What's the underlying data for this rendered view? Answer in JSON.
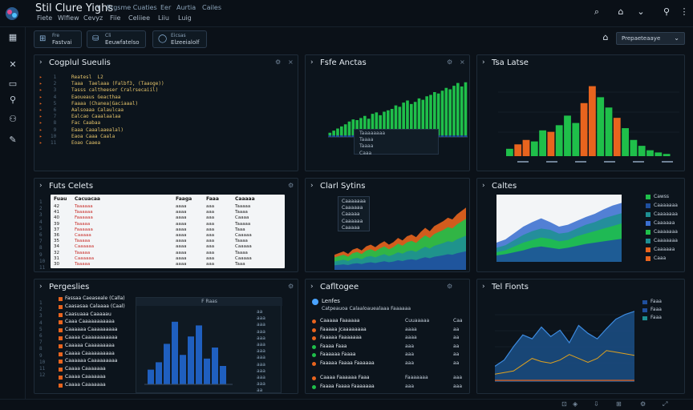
{
  "header": {
    "app_title": "Stil Clure Yighs",
    "menus": [
      "Fiete",
      "Wlfiew",
      "Cevyz",
      "Fiie",
      "Celiiee",
      "Liiu",
      "Luig"
    ],
    "tabs": [
      "Ergsme Cuaties",
      "Eer",
      "Aurtia",
      "Cailes"
    ]
  },
  "toolbar": {
    "buttons": [
      {
        "line1": "Fre",
        "line2": "Fastvai"
      },
      {
        "line1": "Cli",
        "line2": "Eeuwfatelso"
      },
      {
        "line1": "Eicsas",
        "line2": "Elzeeialolf"
      }
    ],
    "select_value": "Prepaeteaaye"
  },
  "panels": {
    "code": {
      "title": "Cogplul Sueulis",
      "lines": [
        "Reatesl  L2",
        "Taaa  Taelaaa (Falbf3, (Taaoge))",
        "Tasss caltheeser Cralrsecaiil)",
        "Eaoueaus Geacthaa",
        "Faaaa (Chanea|Gaciaaal)",
        "Aalsoaaa Calaulcaa",
        "Ealcao Caaalaalaa",
        "Fac Caabaa",
        "Eaaa Caaalaaealal)",
        "Eaoa Caaa Caala",
        "Eoao Caaea"
      ]
    },
    "table": {
      "title": "Futs Celets",
      "headers": [
        "Fuau",
        "Cacuacaa",
        "Faaga",
        "Faaa",
        "Caaaaa"
      ],
      "rows": [
        [
          "42",
          "Taaaaaa",
          "aaaa",
          "aaa",
          "Taaaaa"
        ],
        [
          "41",
          "Taaaaaa",
          "aaaa",
          "aaa",
          "Taaaa"
        ],
        [
          "40",
          "Faaaaaa",
          "aaaa",
          "aaa",
          "Caaaa"
        ],
        [
          "39",
          "Taaaaa",
          "aaaa",
          "aaa",
          "Taaaaa"
        ],
        [
          "37",
          "Faaaaaa",
          "aaaa",
          "aaa",
          "Taaa"
        ],
        [
          "36",
          "Caaaaa",
          "aaaa",
          "aaa",
          "Caaaaa"
        ],
        [
          "35",
          "Taaaaa",
          "aaaa",
          "aaa",
          "Taaaa"
        ],
        [
          "34",
          "Caaaaaa",
          "aaaa",
          "aaa",
          "Caaaaa"
        ],
        [
          "32",
          "Taaaaa",
          "aaaa",
          "aaa",
          "Taaaa"
        ],
        [
          "31",
          "Caaaaaa",
          "aaaa",
          "aaa",
          "Caaaaa"
        ],
        [
          "30",
          "Taaaaa",
          "aaaa",
          "aaa",
          "Taaa"
        ]
      ]
    },
    "properties": {
      "title": "Pergeslies",
      "items": [
        "Fassaa Caeaseale (Calla)",
        "Caasasaa Calaaaa (Caal)",
        "Caasuaaa Caaaaau",
        "Caaa Caaaaaaaaaaa",
        "Caaaaaa Caaaaaaaaa",
        "Caaaa Caaaaaaaaaaa",
        "Caaaaa Caaaaaaaaa",
        "Caaaa Caaaaaaaaaa",
        "Caaaaaa Caaaaaaaaa",
        "Caaaa Caaaaaaa",
        "Caaaa Caaaaaaa",
        "Caaaa Caaaaaaa"
      ],
      "chart_header": "F Raas"
    },
    "changes": {
      "title": "Cafltogee",
      "section": "Lenfes",
      "subtitle": "Catpeauoa Calaaloauealaaa Faaaaaa",
      "rows": [
        [
          "Caaaaa Faaaaaa",
          "Cuuaaaaa",
          "Caa"
        ],
        [
          "Faaaaa Jcaaaaaaaa",
          "aaaa",
          "aa"
        ],
        [
          "Faaaaa Faaaaaaa",
          "aaaa",
          "aa"
        ],
        [
          "Faaaa Faaa",
          "aaa",
          "aa"
        ],
        [
          "Faaaaaa Faaaa",
          "aaa",
          "aa"
        ],
        [
          "Faaaaa Faaaa Faaaaaa",
          "aaa",
          "aa"
        ],
        [
          "Caaaa Faaaaaa Faaa",
          "Faaaaaaa",
          "aaa"
        ],
        [
          "Faaaa Faaaa Faaaaaaa",
          "aaa",
          "aaa"
        ]
      ]
    },
    "charts": {
      "bar_title": "Fsfe Anctas",
      "hist_title": "Tsa Latse",
      "stream_title": "Clarl Sytins",
      "area_title": "Caltes",
      "line_title": "Tel Fionts",
      "legend_area": [
        "Cawss",
        "Caaaaaaa",
        "Caaaaaaa",
        "Caaaaaa",
        "Caaaaaaa",
        "Caaaaaaa",
        "Caaaaaa",
        "Caaa"
      ],
      "legend_line": [
        "Faaa",
        "Faaa",
        "Faaa"
      ],
      "bar_legend": [
        "Taaaaaaaa",
        "Taaaa",
        "Taaaa",
        "Caaa"
      ],
      "stream_tooltip": [
        "Caaaaaaa",
        "Caaaaaa",
        "Caaaaa",
        "Caaaaaa",
        "Caaaaa"
      ]
    }
  },
  "colors": {
    "green": "#1fbf4a",
    "orange": "#e8641e",
    "blue": "#1f4f9e",
    "teal": "#1e8f93",
    "accent": "#4aa3ff"
  },
  "chart_data": [
    {
      "type": "bar",
      "title": "Fsfe Anctas",
      "values": [
        6,
        9,
        12,
        15,
        18,
        22,
        25,
        24,
        27,
        30,
        26,
        33,
        35,
        31,
        36,
        38,
        40,
        45,
        43,
        49,
        52,
        47,
        50,
        55,
        53,
        58,
        60,
        64,
        62,
        66,
        70,
        68,
        73,
        77,
        72,
        78
      ]
    },
    {
      "type": "bar",
      "title": "Tsa Latse",
      "values": [
        10,
        16,
        22,
        20,
        35,
        33,
        42,
        55,
        45,
        72,
        95,
        80,
        66,
        52,
        38,
        22,
        14,
        8,
        5,
        3
      ],
      "orange_index": [
        1,
        2,
        5,
        9,
        10,
        13
      ]
    },
    {
      "type": "area",
      "title": "Clarl Sytins",
      "values": [
        18,
        20,
        22,
        19,
        24,
        26,
        23,
        28,
        30,
        27,
        31,
        34,
        30,
        33,
        38,
        35,
        40,
        42,
        39,
        45,
        50,
        46,
        52,
        55,
        58,
        62,
        60,
        66,
        70,
        74
      ]
    },
    {
      "type": "area",
      "title": "Caltes",
      "series": [
        {
          "values": [
            30,
            35,
            45,
            55,
            62,
            68,
            62,
            55,
            58,
            64,
            70,
            75,
            82,
            88,
            92
          ]
        },
        {
          "values": [
            22,
            26,
            34,
            42,
            48,
            52,
            50,
            44,
            46,
            52,
            58,
            62,
            68,
            72,
            76
          ]
        },
        {
          "values": [
            15,
            18,
            24,
            30,
            34,
            38,
            36,
            32,
            34,
            40,
            44,
            48,
            52,
            56,
            60
          ]
        },
        {
          "values": [
            10,
            12,
            15,
            18,
            22,
            24,
            22,
            20,
            22,
            25,
            28,
            30,
            32,
            34,
            36
          ]
        }
      ]
    },
    {
      "type": "bar",
      "title": "F Raas",
      "values": [
        20,
        30,
        55,
        85,
        40,
        65,
        80,
        35,
        50,
        25
      ]
    },
    {
      "type": "line",
      "title": "Tel Fionts",
      "series": [
        {
          "values": [
            20,
            28,
            45,
            60,
            55,
            70,
            58,
            66,
            50,
            72,
            62,
            55,
            68,
            80,
            86,
            90
          ]
        },
        {
          "values": [
            10,
            12,
            14,
            22,
            30,
            26,
            24,
            28,
            35,
            30,
            25,
            30,
            40,
            38,
            36,
            34
          ]
        }
      ]
    }
  ]
}
